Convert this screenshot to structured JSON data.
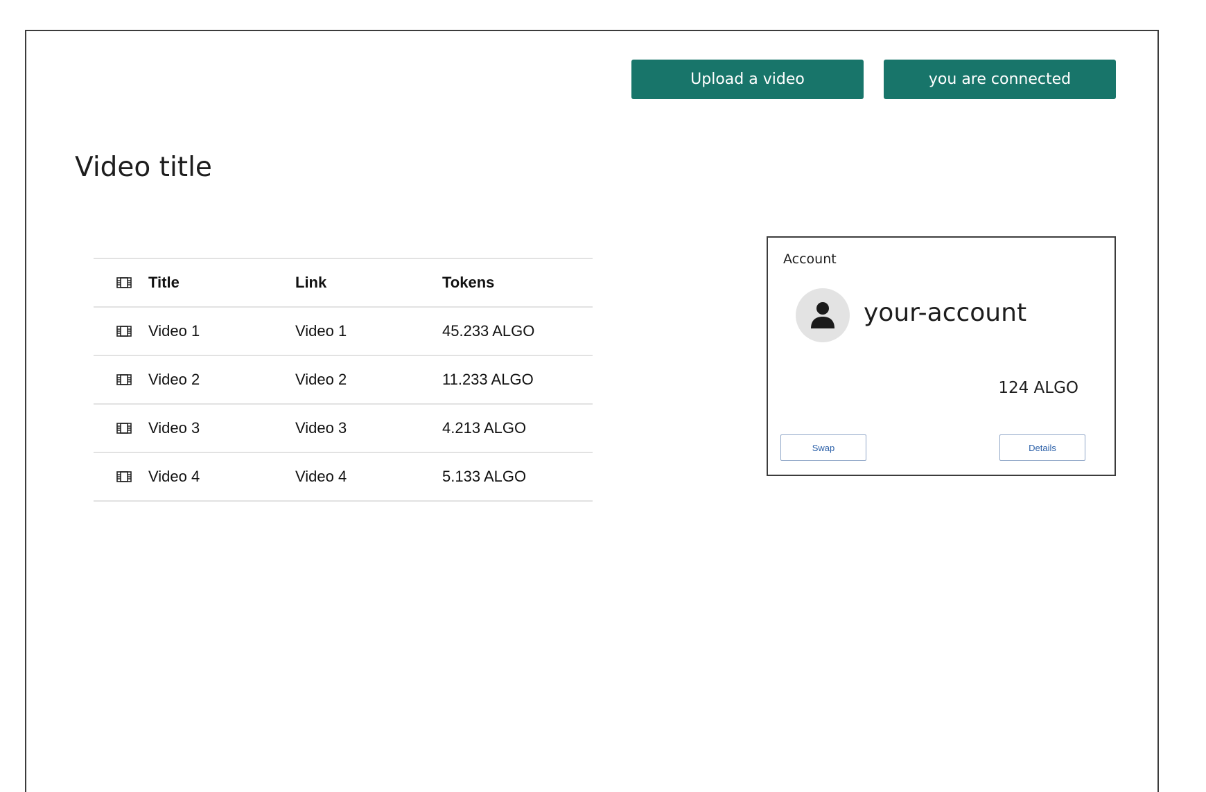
{
  "header": {
    "upload_label": "Upload a video",
    "connected_label": "you are connected"
  },
  "page_title": "Video title",
  "table": {
    "columns": [
      "Title",
      "Link",
      "Tokens"
    ],
    "rows": [
      {
        "title": "Video 1",
        "link": "Video 1",
        "tokens": "45.233 ALGO"
      },
      {
        "title": "Video 2",
        "link": "Video 2",
        "tokens": "11.233 ALGO"
      },
      {
        "title": "Video 3",
        "link": "Video 3",
        "tokens": "4.213 ALGO"
      },
      {
        "title": "Video 4",
        "link": "Video 4",
        "tokens": "5.133 ALGO"
      }
    ],
    "row_icon": "film-icon"
  },
  "account": {
    "label": "Account",
    "name": "your-account",
    "balance": "124 ALGO",
    "avatar_icon": "user-icon",
    "swap_label": "Swap",
    "details_label": "Details"
  },
  "colors": {
    "primary_button": "#18756a",
    "secondary_button_text": "#2a5fa8"
  }
}
